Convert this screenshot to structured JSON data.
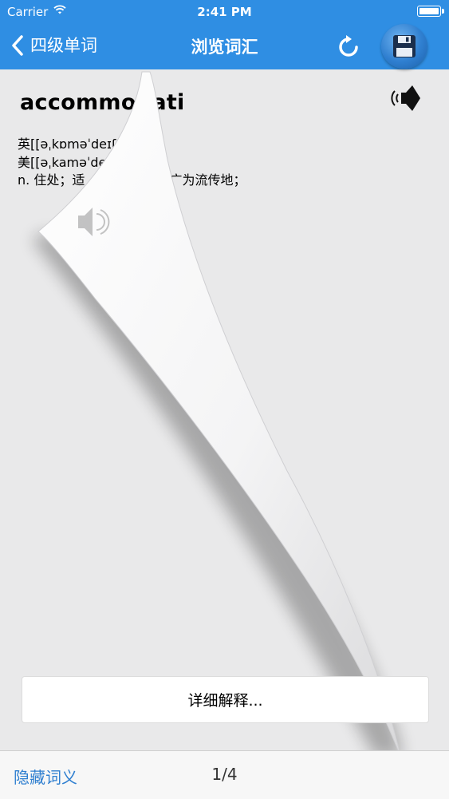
{
  "status_bar": {
    "carrier": "Carrier",
    "time": "2:41 PM"
  },
  "nav": {
    "back_label": "四级单词",
    "title": "浏览词汇",
    "refresh_icon": "refresh-icon",
    "save_icon": "save-icon"
  },
  "word": {
    "text": "accommodati",
    "uk_label": "英",
    "uk_pron": "[[əˌkɒməˈdeɪʃn",
    "us_label": "美",
    "us_pron": "[[əˌkaməˈdeɪʃ",
    "meaning_a": "n. 住处；适",
    "meaning_b": "广为流传地；"
  },
  "detail_button": "详细解释...",
  "bottom": {
    "hide_label": "隐藏词义",
    "pager": "1/4"
  },
  "colors": {
    "accent": "#2f8ee3",
    "link": "#2f7fd0"
  }
}
